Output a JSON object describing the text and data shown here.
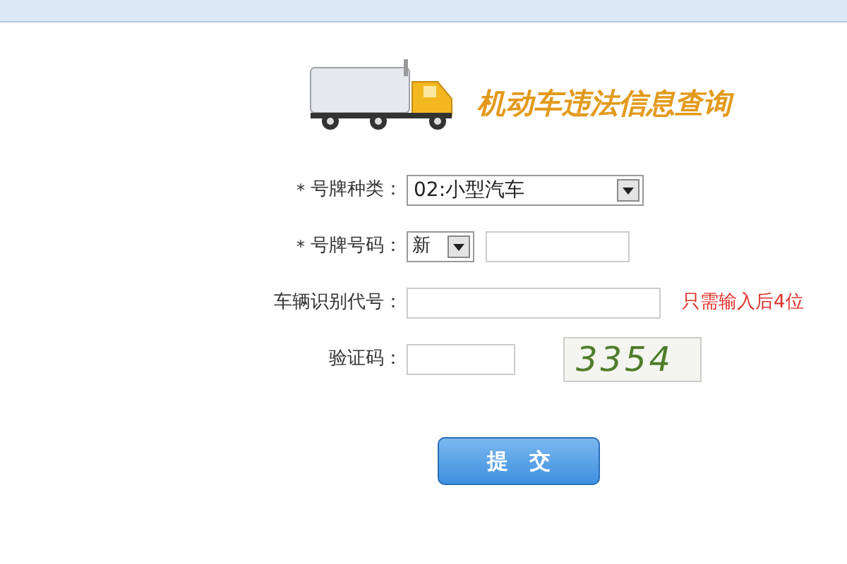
{
  "banner": {
    "title": "机动车违法信息查询"
  },
  "form": {
    "rows": [
      {
        "kind": "select",
        "mark": "*",
        "label": "号牌种类：",
        "value": "02:小型汽车"
      },
      {
        "kind": "plate",
        "mark": "*",
        "label": "号牌号码：",
        "prefix": "新"
      },
      {
        "kind": "input",
        "label": "车辆识别代号：",
        "hint": "只需输入后4位"
      },
      {
        "kind": "captcha",
        "label": "验证码：",
        "code": "3354"
      }
    ]
  },
  "submit": {
    "label": "提　交"
  }
}
